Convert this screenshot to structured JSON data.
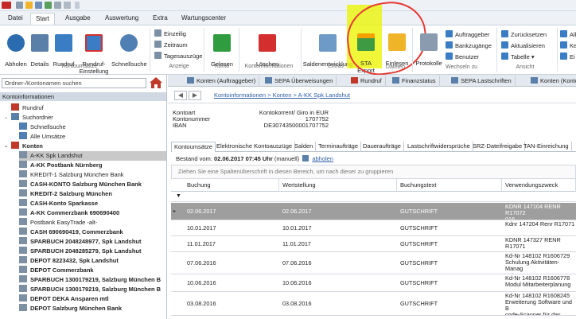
{
  "colors": {
    "ribbon_accent": "#2b579a",
    "highlight": "#ebf500",
    "circle": "#e53935",
    "selected_row": "#9e9e9e"
  },
  "ribbon_tabs": [
    "Datei",
    "Start",
    "Ausgabe",
    "Auswertung",
    "Extra",
    "Wartungscenter"
  ],
  "ribbon": {
    "abholen": "Abholen",
    "details": "Details",
    "rundruf": "Rundruf",
    "rundruf_einstellung": "Rundruf-\nEinstellung",
    "schnellsuche": "Schnellsuche",
    "group_kontoumsaetze": "Kontoumsätze",
    "einzelig": "Einzeilig",
    "zeitraum": "Zeitraum",
    "tagesauszuege": "Tagesauszüge",
    "group_anzeige": "Anzeige",
    "gelesen": "Gelesen",
    "group_konto": "Konto",
    "loeschen": "Löschen",
    "group_kontoinformationen": "Kontoinformationen",
    "saldenentwicklung": "Saldenentwicklung",
    "group_extras": "Extras",
    "sta_export": "STA\nExport",
    "einlesen": "Einlesen",
    "group_dateien": "Dateien",
    "protokolle": "Protokolle",
    "auftraggeber": "Auftraggeber",
    "bankzugaenge": "Bankzugänge",
    "benutzer": "Benutzer",
    "group_wechseln": "Wechseln zu",
    "zurueck": "Zurücksetzen",
    "aktualisieren": "Aktualisieren",
    "tabelle": "Tabelle ▾",
    "group_ansicht": "Ansicht",
    "all1": "All",
    "ke": "Ke",
    "ei": "Ei"
  },
  "left": {
    "search_placeholder": "Ordner-/Kontonamen suchen",
    "header": "Kontoinformationen",
    "items": [
      {
        "label": "Rundruf",
        "indent": 1,
        "bold": false
      },
      {
        "label": "Suchordner",
        "indent": 0,
        "bold": false,
        "exp": "−"
      },
      {
        "label": "Schnellsuche",
        "indent": 2,
        "bold": false
      },
      {
        "label": "Alle Umsätze",
        "indent": 2,
        "bold": false
      },
      {
        "label": "Konten",
        "indent": 0,
        "bold": true,
        "exp": "−"
      },
      {
        "label": "A-KK  Spk Landshut",
        "indent": 2,
        "bold": false,
        "sel": true
      },
      {
        "label": "A-KK Postbank Nürnberg",
        "indent": 2,
        "bold": true
      },
      {
        "label": "KREDIT-1 Salzburg München Bank",
        "indent": 2,
        "bold": false
      },
      {
        "label": "CASH-KONTO Salzburg München Bank",
        "indent": 2,
        "bold": true
      },
      {
        "label": "KREDIT-2 Salzburg München",
        "indent": 2,
        "bold": true
      },
      {
        "label": "CASH-Konto Sparkasse",
        "indent": 2,
        "bold": true
      },
      {
        "label": "A-KK Commerzbank 690690400",
        "indent": 2,
        "bold": true
      },
      {
        "label": "Postbank EasyTrade -alt-",
        "indent": 2,
        "bold": false
      },
      {
        "label": "CASH 690690419, Commerzbank",
        "indent": 2,
        "bold": true
      },
      {
        "label": "SPARBUCH  2048248977, Spk Landshut",
        "indent": 2,
        "bold": true
      },
      {
        "label": "SPARBUCH  2048285279, Spk Landshut",
        "indent": 2,
        "bold": true
      },
      {
        "label": "DEPOT 8223432, Spk Landshut",
        "indent": 2,
        "bold": true
      },
      {
        "label": "DEPOT Commerzbank",
        "indent": 2,
        "bold": true
      },
      {
        "label": "SPARBUCH 1300179219, Salzburg München B",
        "indent": 2,
        "bold": true
      },
      {
        "label": "SPARBUCH 1300179219, Salzburg München B",
        "indent": 2,
        "bold": true
      },
      {
        "label": "DEPOT DEKA Ansparen mtl",
        "indent": 2,
        "bold": true
      },
      {
        "label": "DEPOT Salzburg München Bank",
        "indent": 2,
        "bold": true
      }
    ]
  },
  "doc_tabs": [
    "Konten (Auftraggeber)",
    "SEPA Überweisungen",
    "Rundruf",
    "Finanzstatus",
    "SEPA Lastschriften",
    "Konten (Konto"
  ],
  "breadcrumb": "Kontoinformationen > Konten > A-KK  Spk Landshut",
  "account": {
    "kontoart_label": "Kontoart",
    "kontoart": "Kontokorrent/ Giro in EUR",
    "kontonummer_label": "Kontonummer",
    "kontonummer": "1707752",
    "iban_label": "IBAN",
    "iban": "DE30743500001707752"
  },
  "subtabs": [
    "Kontoumsätze",
    "Elektronische Kontoauszüge",
    "Salden",
    "Terminaufträge",
    "Daueraufträge",
    "Lastschriftwidersprüche",
    "SRZ-Dateifreigabe",
    "TAN-Einreichung"
  ],
  "bestand": {
    "prefix": "Bestand vom:",
    "date": "02.06.2017 07:45 Uhr",
    "suffix": "(manuell)",
    "link": "abholen"
  },
  "group_hint": "Ziehen Sie eine Spaltenüberschrift in diesen Bereich, um nach dieser zu gruppieren",
  "columns": [
    "Buchung",
    "Wertstellung",
    "Buchungstext",
    "Verwendungszweck"
  ],
  "rows": [
    {
      "buchung": "02.06.2017",
      "wert": "02.06.2017",
      "text": "GUTSCHRIFT",
      "zweck": "KDNR 147104 RENR R17072\n016",
      "sel": true
    },
    {
      "buchung": "10.01.2017",
      "wert": "10.01.2017",
      "text": "GUTSCHRIFT",
      "zweck": "Kdnr 147204 Renr R17071"
    },
    {
      "buchung": "11.01.2017",
      "wert": "11.01.2017",
      "text": "GUTSCHRIFT",
      "zweck": "KDNR 147327 RENR R17071"
    },
    {
      "buchung": "07.06.2016",
      "wert": "07.06.2016",
      "text": "GUTSCHRIFT",
      "zweck": "Kd-Nr 148102 R1606729\nSchulung Aktivitäten-Manag\nent"
    },
    {
      "buchung": "10.06.2016",
      "wert": "10.06.2016",
      "text": "GUTSCHRIFT",
      "zweck": "Kd-Nr 148102 R1606778\nModul Mitarbeiterplanung"
    },
    {
      "buchung": "03.08.2016",
      "wert": "03.08.2016",
      "text": "GUTSCHRIFT",
      "zweck": "Kd-Nr 148102 R1608245\nErweiterung Software und B\ncode-Scanner für das Rechn"
    }
  ]
}
